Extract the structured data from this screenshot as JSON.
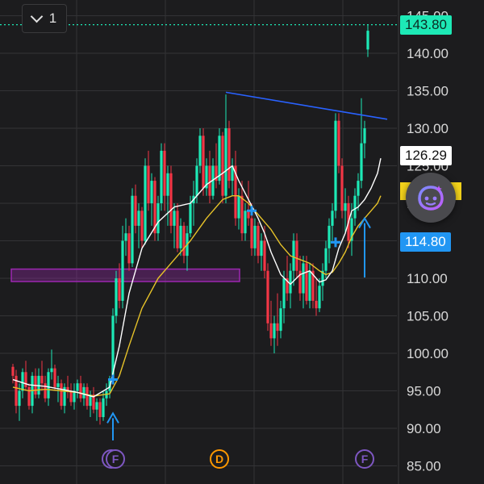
{
  "toggle": {
    "count": "1"
  },
  "price_tags": {
    "last": "143.80",
    "mid": "126.29",
    "low": "114.80"
  },
  "colors": {
    "up": "#1de9b6",
    "down": "#f23645",
    "ma_fast": "#ffffff",
    "ma_slow": "#e6c229",
    "trendline": "#2962ff",
    "zone": "#9c27b0",
    "grid": "#333336",
    "tag_blue": "#2196f3",
    "tag_yellow": "#f2d21b",
    "event_f": "#7e57c2",
    "event_d": "#ff9800"
  },
  "icons": {
    "collapse": "chevron-down-icon",
    "assistant": "assistant-face-icon"
  },
  "events": [
    {
      "label": "F",
      "kind": "F",
      "date_index": 31
    },
    {
      "label": "D",
      "kind": "D",
      "date_index": 64
    },
    {
      "label": "F",
      "kind": "F",
      "date_index": 109
    }
  ],
  "chart_data": {
    "type": "candlestick",
    "ylim": [
      85,
      146
    ],
    "yticks": [
      "145.00",
      "140.00",
      "135.00",
      "130.00",
      "125.00",
      "120.00",
      "115.00",
      "110.00",
      "105.00",
      "100.00",
      "95.00",
      "90.00",
      "85.00"
    ],
    "grid": true,
    "resistance_zone": [
      110.0,
      110.8
    ],
    "current_price": 143.8,
    "trendline": [
      {
        "i": 66,
        "price": 134.8
      },
      {
        "i": 116,
        "price": 131.2
      }
    ],
    "candles": [
      [
        98.2,
        98.6,
        96.0,
        97.0
      ],
      [
        97.0,
        97.8,
        92.0,
        93.0
      ],
      [
        93.0,
        96.0,
        91.0,
        95.0
      ],
      [
        95.0,
        98.0,
        94.0,
        97.5
      ],
      [
        97.5,
        99.0,
        95.0,
        95.5
      ],
      [
        95.5,
        96.0,
        92.5,
        93.0
      ],
      [
        93.0,
        97.5,
        92.0,
        97.0
      ],
      [
        97.0,
        98.0,
        94.0,
        94.5
      ],
      [
        94.5,
        98.0,
        94.0,
        97.0
      ],
      [
        97.0,
        99.0,
        95.0,
        96.0
      ],
      [
        96.0,
        97.0,
        93.5,
        94.0
      ],
      [
        94.0,
        98.0,
        93.0,
        97.5
      ],
      [
        97.5,
        100.5,
        96.5,
        98.0
      ],
      [
        98.0,
        98.5,
        95.0,
        95.5
      ],
      [
        95.5,
        97.0,
        93.5,
        96.0
      ],
      [
        96.0,
        96.5,
        92.5,
        93.0
      ],
      [
        93.0,
        96.0,
        92.0,
        95.5
      ],
      [
        95.5,
        97.0,
        94.0,
        95.0
      ],
      [
        95.0,
        96.0,
        93.0,
        93.5
      ],
      [
        93.5,
        96.0,
        92.5,
        95.0
      ],
      [
        95.0,
        96.5,
        94.0,
        96.0
      ],
      [
        96.0,
        97.0,
        93.5,
        94.0
      ],
      [
        94.0,
        96.0,
        93.0,
        95.5
      ],
      [
        95.5,
        96.0,
        92.5,
        93.0
      ],
      [
        93.0,
        95.0,
        91.5,
        94.5
      ],
      [
        94.5,
        95.5,
        92.0,
        92.5
      ],
      [
        92.5,
        94.0,
        91.0,
        93.5
      ],
      [
        93.5,
        94.0,
        90.5,
        91.5
      ],
      [
        91.5,
        95.0,
        91.0,
        94.0
      ],
      [
        94.0,
        96.0,
        93.0,
        95.0
      ],
      [
        95.0,
        97.0,
        94.0,
        96.5
      ],
      [
        96.5,
        106.0,
        96.0,
        105.0
      ],
      [
        105.0,
        111.0,
        104.0,
        110.0
      ],
      [
        110.0,
        112.0,
        106.0,
        107.0
      ],
      [
        107.0,
        117.0,
        106.0,
        115.0
      ],
      [
        115.0,
        118.0,
        113.0,
        116.0
      ],
      [
        116.0,
        117.0,
        111.0,
        112.0
      ],
      [
        112.0,
        122.0,
        111.5,
        121.0
      ],
      [
        121.0,
        122.5,
        116.0,
        117.0
      ],
      [
        117.0,
        120.0,
        114.0,
        119.0
      ],
      [
        119.0,
        119.5,
        114.0,
        115.0
      ],
      [
        115.0,
        126.0,
        114.5,
        125.0
      ],
      [
        125.0,
        127.0,
        119.0,
        120.0
      ],
      [
        120.0,
        124.0,
        117.0,
        123.0
      ],
      [
        123.0,
        123.5,
        115.0,
        116.0
      ],
      [
        116.0,
        121.0,
        115.0,
        120.0
      ],
      [
        120.0,
        128.0,
        119.0,
        127.0
      ],
      [
        127.0,
        128.0,
        119.0,
        121.0
      ],
      [
        121.0,
        125.0,
        117.0,
        124.0
      ],
      [
        124.0,
        125.0,
        116.0,
        117.0
      ],
      [
        117.0,
        120.0,
        114.0,
        119.0
      ],
      [
        119.0,
        120.0,
        113.5,
        114.0
      ],
      [
        114.0,
        118.0,
        113.0,
        117.0
      ],
      [
        117.0,
        117.5,
        112.0,
        113.0
      ],
      [
        113.0,
        117.0,
        111.0,
        116.0
      ],
      [
        116.0,
        121.0,
        115.5,
        120.0
      ],
      [
        120.0,
        123.0,
        117.0,
        121.0
      ],
      [
        121.0,
        126.0,
        120.0,
        125.0
      ],
      [
        125.0,
        130.0,
        124.0,
        129.0
      ],
      [
        129.0,
        130.0,
        121.0,
        122.0
      ],
      [
        122.0,
        126.0,
        121.0,
        125.0
      ],
      [
        125.0,
        127.0,
        120.0,
        121.0
      ],
      [
        121.0,
        126.0,
        120.5,
        125.0
      ],
      [
        125.0,
        128.0,
        122.0,
        123.0
      ],
      [
        123.0,
        130.0,
        122.5,
        129.0
      ],
      [
        129.0,
        129.5,
        120.0,
        121.0
      ],
      [
        121.0,
        134.5,
        120.0,
        130.0
      ],
      [
        130.0,
        131.0,
        122.0,
        123.0
      ],
      [
        123.0,
        126.0,
        121.0,
        125.0
      ],
      [
        125.0,
        127.0,
        117.0,
        118.0
      ],
      [
        118.0,
        122.0,
        116.5,
        121.0
      ],
      [
        121.0,
        123.0,
        115.0,
        116.0
      ],
      [
        116.0,
        120.0,
        115.0,
        119.0
      ],
      [
        119.0,
        123.0,
        117.0,
        118.0
      ],
      [
        118.0,
        120.0,
        113.0,
        114.0
      ],
      [
        114.0,
        118.0,
        113.0,
        117.0
      ],
      [
        117.0,
        117.5,
        112.0,
        113.0
      ],
      [
        113.0,
        116.0,
        111.0,
        115.0
      ],
      [
        115.0,
        117.0,
        110.0,
        111.0
      ],
      [
        111.0,
        112.0,
        103.0,
        104.0
      ],
      [
        104.0,
        107.0,
        101.0,
        102.0
      ],
      [
        102.0,
        105.0,
        100.0,
        104.0
      ],
      [
        104.0,
        108.0,
        101.0,
        103.0
      ],
      [
        103.0,
        107.0,
        102.0,
        106.0
      ],
      [
        106.0,
        111.0,
        104.0,
        110.0
      ],
      [
        110.0,
        113.0,
        107.0,
        108.0
      ],
      [
        108.0,
        112.0,
        106.0,
        111.0
      ],
      [
        111.0,
        116.0,
        109.0,
        115.0
      ],
      [
        115.0,
        116.0,
        110.0,
        111.0
      ],
      [
        111.0,
        113.0,
        107.0,
        108.0
      ],
      [
        108.0,
        113.0,
        106.0,
        112.0
      ],
      [
        112.0,
        113.0,
        106.5,
        107.0
      ],
      [
        107.0,
        112.0,
        106.0,
        111.0
      ],
      [
        111.0,
        112.0,
        106.0,
        107.0
      ],
      [
        107.0,
        110.0,
        105.0,
        106.0
      ],
      [
        106.0,
        110.0,
        105.5,
        109.0
      ],
      [
        109.0,
        112.0,
        107.0,
        111.0
      ],
      [
        111.0,
        115.0,
        110.0,
        114.0
      ],
      [
        114.0,
        118.0,
        112.0,
        117.0
      ],
      [
        117.0,
        120.0,
        115.0,
        119.0
      ],
      [
        119.0,
        132.0,
        118.0,
        131.0
      ],
      [
        131.0,
        132.0,
        124.0,
        125.0
      ],
      [
        125.0,
        126.0,
        118.0,
        119.0
      ],
      [
        119.0,
        122.0,
        116.0,
        120.0
      ],
      [
        120.0,
        121.0,
        114.0,
        115.0
      ],
      [
        115.0,
        120.0,
        113.0,
        118.0
      ],
      [
        118.0,
        122.0,
        117.0,
        121.0
      ],
      [
        121.0,
        124.0,
        119.0,
        123.0
      ],
      [
        123.0,
        134.0,
        122.0,
        128.0
      ],
      [
        128.0,
        131.0,
        126.0,
        130.0
      ],
      [
        140.5,
        143.8,
        139.5,
        143.0
      ]
    ],
    "ma_fast": [
      [
        0,
        96.5
      ],
      [
        5,
        95.8
      ],
      [
        10,
        95.6
      ],
      [
        15,
        95.2
      ],
      [
        20,
        94.8
      ],
      [
        25,
        94.2
      ],
      [
        30,
        95.5
      ],
      [
        33,
        101.0
      ],
      [
        36,
        108.0
      ],
      [
        40,
        114.0
      ],
      [
        45,
        117.5
      ],
      [
        50,
        119.5
      ],
      [
        55,
        120.0
      ],
      [
        60,
        122.5
      ],
      [
        65,
        124.0
      ],
      [
        68,
        125.0
      ],
      [
        70,
        123.0
      ],
      [
        73,
        120.5
      ],
      [
        76,
        118.0
      ],
      [
        78,
        116.0
      ],
      [
        80,
        113.5
      ],
      [
        83,
        110.5
      ],
      [
        86,
        109.2
      ],
      [
        89,
        110.5
      ],
      [
        92,
        111.0
      ],
      [
        95,
        109.5
      ],
      [
        97,
        109.8
      ],
      [
        99,
        111.0
      ],
      [
        101,
        114.0
      ],
      [
        103,
        116.0
      ],
      [
        105,
        119.0
      ],
      [
        107,
        119.5
      ],
      [
        109,
        120.5
      ],
      [
        111,
        122.0
      ],
      [
        113,
        124.0
      ],
      [
        114,
        126.0
      ]
    ],
    "ma_slow": [
      [
        0,
        95.5
      ],
      [
        5,
        95.0
      ],
      [
        10,
        95.2
      ],
      [
        15,
        95.0
      ],
      [
        20,
        94.8
      ],
      [
        25,
        94.3
      ],
      [
        30,
        94.6
      ],
      [
        33,
        97.0
      ],
      [
        36,
        101.0
      ],
      [
        40,
        106.0
      ],
      [
        45,
        110.0
      ],
      [
        50,
        112.5
      ],
      [
        55,
        115.0
      ],
      [
        60,
        118.0
      ],
      [
        65,
        120.5
      ],
      [
        68,
        121.0
      ],
      [
        70,
        121.0
      ],
      [
        73,
        120.0
      ],
      [
        76,
        118.5
      ],
      [
        78,
        117.5
      ],
      [
        80,
        116.5
      ],
      [
        83,
        114.5
      ],
      [
        86,
        113.0
      ],
      [
        89,
        112.5
      ],
      [
        92,
        112.0
      ],
      [
        95,
        111.0
      ],
      [
        97,
        110.5
      ],
      [
        99,
        110.8
      ],
      [
        101,
        112.0
      ],
      [
        103,
        113.5
      ],
      [
        105,
        115.5
      ],
      [
        107,
        117.0
      ],
      [
        109,
        118.0
      ],
      [
        111,
        119.0
      ],
      [
        113,
        120.0
      ],
      [
        114,
        121.0
      ]
    ]
  }
}
